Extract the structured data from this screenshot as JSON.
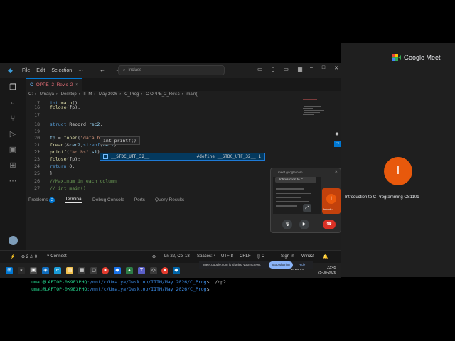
{
  "meet": {
    "logo_text": "Google Meet",
    "participant_initial": "I",
    "meeting_title": "Introduction to C Programming CS1101"
  },
  "vscode": {
    "menu": [
      "File",
      "Edit",
      "Selection"
    ],
    "nav_arrows": "← →",
    "search_placeholder": "Inclass",
    "more_menu": "···",
    "layout_icons": "▭ ▯ ▭ ▦",
    "window_controls": {
      "minimize": "–",
      "maximize": "□",
      "close": "✕"
    },
    "tab": {
      "label": "OPPE_2_Rev.c",
      "modified_count": "2"
    },
    "breadcrumb": [
      "C:",
      "Umaiya",
      "Desktop",
      "IITM",
      "May 2026",
      "C_Prog",
      "C  OPPE_2_Rev.c",
      "main()"
    ],
    "code_lines": [
      {
        "num": "7",
        "parts": [
          [
            "kw",
            "int "
          ],
          [
            "fn",
            "main"
          ],
          [
            "plain",
            "()"
          ]
        ]
      },
      {
        "num": "16",
        "parts": [
          [
            "fn",
            "fclose"
          ],
          [
            "plain",
            "(fp);"
          ]
        ]
      },
      {
        "num": "17",
        "parts": []
      },
      {
        "num": "18",
        "parts": [
          [
            "kw",
            "struct "
          ],
          [
            "plain",
            "Record "
          ],
          [
            "id",
            "rec2"
          ],
          [
            "plain",
            ";"
          ]
        ]
      },
      {
        "num": "19",
        "parts": []
      },
      {
        "num": "20",
        "parts": [
          [
            "id",
            "fp"
          ],
          [
            "plain",
            " = "
          ],
          [
            "fn",
            "fopen"
          ],
          [
            "plain",
            "("
          ],
          [
            "str",
            "\"data.bin\""
          ],
          [
            "plain",
            ", "
          ],
          [
            "str",
            "\"rb\""
          ],
          [
            "plain",
            ");"
          ]
        ]
      },
      {
        "num": "21",
        "parts": [
          [
            "fn",
            "fread"
          ],
          [
            "plain",
            "(&"
          ],
          [
            "id",
            "rec2"
          ],
          [
            "plain",
            ","
          ],
          [
            "kw",
            "sizeof"
          ],
          [
            "plain",
            "("
          ],
          [
            "id",
            "rec2"
          ],
          [
            "plain",
            ")"
          ]
        ]
      },
      {
        "num": "22",
        "parts": [
          [
            "fn",
            "printf"
          ],
          [
            "plain",
            "("
          ],
          [
            "str",
            "\"%d %s\""
          ],
          [
            "plain",
            ","
          ],
          [
            "id",
            "s1"
          ],
          [
            "plain",
            ")"
          ]
        ]
      },
      {
        "num": "23",
        "parts": [
          [
            "fn",
            "fclose"
          ],
          [
            "plain",
            "(fp);"
          ]
        ]
      },
      {
        "num": "24",
        "parts": [
          [
            "kw",
            "return "
          ],
          [
            "plain",
            "0;"
          ]
        ]
      },
      {
        "num": "25",
        "parts": [
          [
            "plain",
            "}"
          ]
        ]
      },
      {
        "num": "26",
        "parts": [
          [
            "cm",
            "//Maximum in each column"
          ]
        ]
      },
      {
        "num": "27",
        "parts": [
          [
            "cm",
            "// int main()"
          ]
        ]
      }
    ],
    "signature_tooltip": "int printf()",
    "suggestion": {
      "label": "__STDC_UTF_32__",
      "detail": "#define __STDC_UTF_32__ 1"
    },
    "panel_tabs": [
      {
        "label": "Problems",
        "badge": "2"
      },
      {
        "label": "Terminal"
      },
      {
        "label": "Debug Console"
      },
      {
        "label": "Ports"
      },
      {
        "label": "Query Results"
      }
    ],
    "terminal_shell": "wsl",
    "terminal_lines": [
      {
        "user": "umai@LAPTOP-0K9E3PHQ",
        "path": ":/mnt/c/Umaiya/Desktop/IITM/May 2026/C_Prog",
        "cmd": "$ gcc -g OPPE_2_Rev.c"
      },
      {
        "user": "umai@LAPTOP-0K9E3PHQ",
        "path": ":/mnt/c/Umaiya/Desktop/IITM/May 2026/C_Prog",
        "cmd": "$ ./op2"
      },
      {
        "user": "umai@LAPTOP-0K9E3PHQ",
        "path": ":/mnt/c/Umaiya/Desktop/IITM/May 2026/C_Prog",
        "cmd": "$ "
      }
    ],
    "status": {
      "errors": "2",
      "warnings": "0",
      "connect": "Connect",
      "position": "Ln 22, Col 18",
      "spaces": "Spaces: 4",
      "encoding": "UTF-8",
      "eol": "CRLF",
      "lang": "C",
      "sign_in": "Sign In",
      "platform": "Win32"
    }
  },
  "pip": {
    "url": "meet.google.com",
    "tab_title": "Introduction to C",
    "tile_label": "Introdu..."
  },
  "sharebar": {
    "text": "meet.google.com is sharing your screen.",
    "stop": "Stop sharing",
    "hide": "Hide"
  },
  "taskbar": {
    "tray_lang": "ENG IN",
    "time": "23:45",
    "date": "25-08-2026"
  },
  "colors": {
    "accent_blue": "#0078d4",
    "meet_orange": "#e8590c",
    "stop_sharing": "#8ab4f8"
  }
}
